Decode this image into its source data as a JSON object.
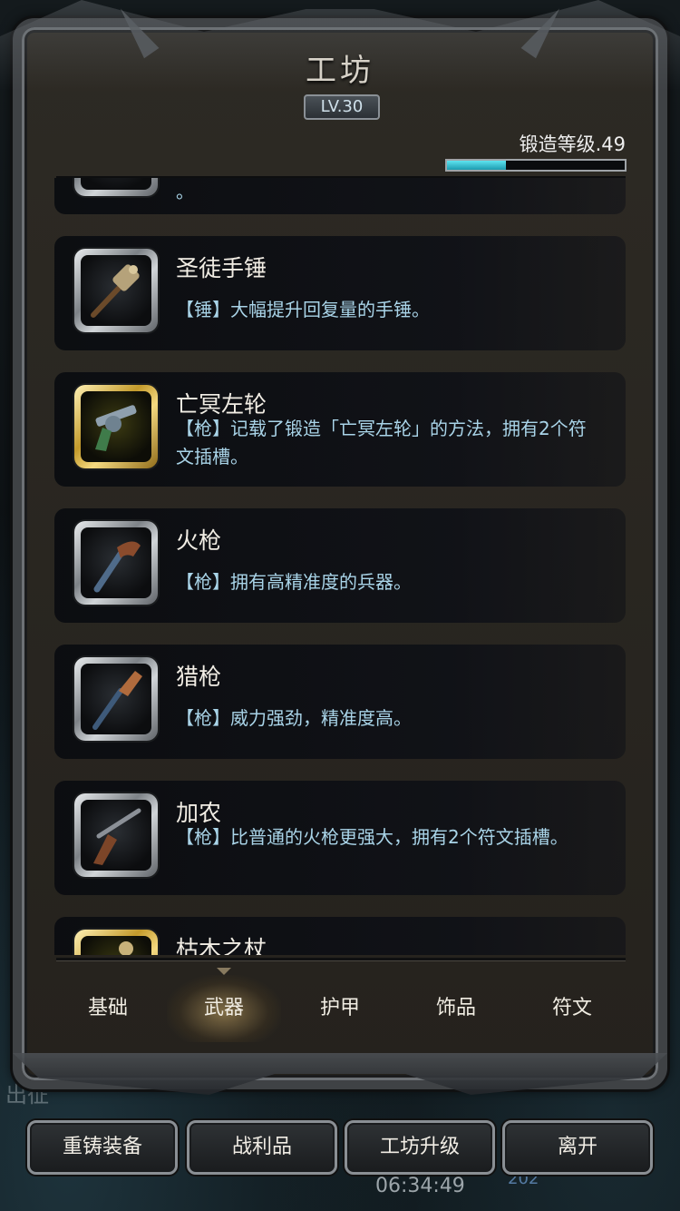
{
  "header": {
    "title": "工坊",
    "level": "LV.30",
    "forge_level": "锻造等级.49",
    "forge_progress": 0.33
  },
  "partial_item_desc": "。",
  "items": [
    {
      "name": "圣徒手锤",
      "desc": "【锤】大幅提升回复量的手锤。",
      "icon": "holy-hammer-icon",
      "frame": "silver"
    },
    {
      "name": "亡冥左轮",
      "desc": "【枪】记载了锻造「亡冥左轮」的方法，拥有2个符文插槽。",
      "icon": "revolver-icon",
      "frame": "gold"
    },
    {
      "name": "火枪",
      "desc": "【枪】拥有高精准度的兵器。",
      "icon": "flintlock-pistol-icon",
      "frame": "silver"
    },
    {
      "name": "猎枪",
      "desc": "【枪】威力强劲，精准度高。",
      "icon": "hunting-gun-icon",
      "frame": "silver"
    },
    {
      "name": "加农",
      "desc": "【枪】比普通的火枪更强大，拥有2个符文插槽。",
      "icon": "cannon-gun-icon",
      "frame": "silver"
    },
    {
      "name": "枯木之杖",
      "desc": "",
      "icon": "withered-staff-icon",
      "frame": "gold"
    }
  ],
  "tabs": [
    "基础",
    "武器",
    "护甲",
    "饰品",
    "符文"
  ],
  "active_tab": "武器",
  "buttons": {
    "reforge": "重铸装备",
    "loot": "战利品",
    "upgrade": "工坊升级",
    "leave": "离开"
  },
  "background": {
    "label": "出征",
    "time": "06:34:49",
    "count": "202"
  }
}
